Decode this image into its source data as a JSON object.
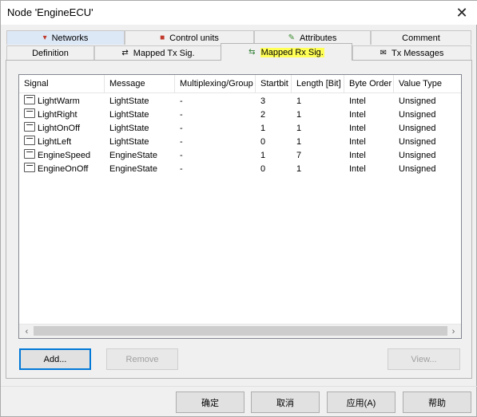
{
  "window": {
    "title": "Node 'EngineECU'",
    "close_glyph": "✕"
  },
  "tabs_row1": [
    {
      "label": "Networks",
      "icon": "networks-icon",
      "glyph": "▾"
    },
    {
      "label": "Control units",
      "icon": "control-units-icon",
      "glyph": "■"
    },
    {
      "label": "Attributes",
      "icon": "attributes-icon",
      "glyph": "✎"
    },
    {
      "label": "Comment",
      "icon": "",
      "glyph": ""
    }
  ],
  "tabs_row2": [
    {
      "label": "Definition",
      "icon": "",
      "glyph": ""
    },
    {
      "label": "Mapped Tx Sig.",
      "icon": "mapped-tx-icon",
      "glyph": "⇄"
    },
    {
      "label": "Mapped Rx Sig.",
      "icon": "mapped-rx-icon",
      "glyph": "⇆",
      "active": true
    },
    {
      "label": "Tx Messages",
      "icon": "tx-messages-icon",
      "glyph": "✉"
    }
  ],
  "list": {
    "columns": [
      "Signal",
      "Message",
      "Multiplexing/Group",
      "Startbit",
      "Length [Bit]",
      "Byte Order",
      "Value Type"
    ],
    "rows": [
      {
        "signal": "LightWarm",
        "message": "LightState",
        "mux": "-",
        "startbit": "3",
        "length": "1",
        "byte_order": "Intel",
        "value_type": "Unsigned"
      },
      {
        "signal": "LightRight",
        "message": "LightState",
        "mux": "-",
        "startbit": "2",
        "length": "1",
        "byte_order": "Intel",
        "value_type": "Unsigned"
      },
      {
        "signal": "LightOnOff",
        "message": "LightState",
        "mux": "-",
        "startbit": "1",
        "length": "1",
        "byte_order": "Intel",
        "value_type": "Unsigned"
      },
      {
        "signal": "LightLeft",
        "message": "LightState",
        "mux": "-",
        "startbit": "0",
        "length": "1",
        "byte_order": "Intel",
        "value_type": "Unsigned"
      },
      {
        "signal": "EngineSpeed",
        "message": "EngineState",
        "mux": "-",
        "startbit": "1",
        "length": "7",
        "byte_order": "Intel",
        "value_type": "Unsigned"
      },
      {
        "signal": "EngineOnOff",
        "message": "EngineState",
        "mux": "-",
        "startbit": "0",
        "length": "1",
        "byte_order": "Intel",
        "value_type": "Unsigned"
      }
    ]
  },
  "buttons": {
    "add": "Add...",
    "remove": "Remove",
    "view": "View...",
    "ok": "确定",
    "cancel": "取消",
    "apply": "应用(A)",
    "help": "帮助"
  },
  "colors": {
    "highlight": "#ffff55",
    "accent": "#0078d7"
  }
}
